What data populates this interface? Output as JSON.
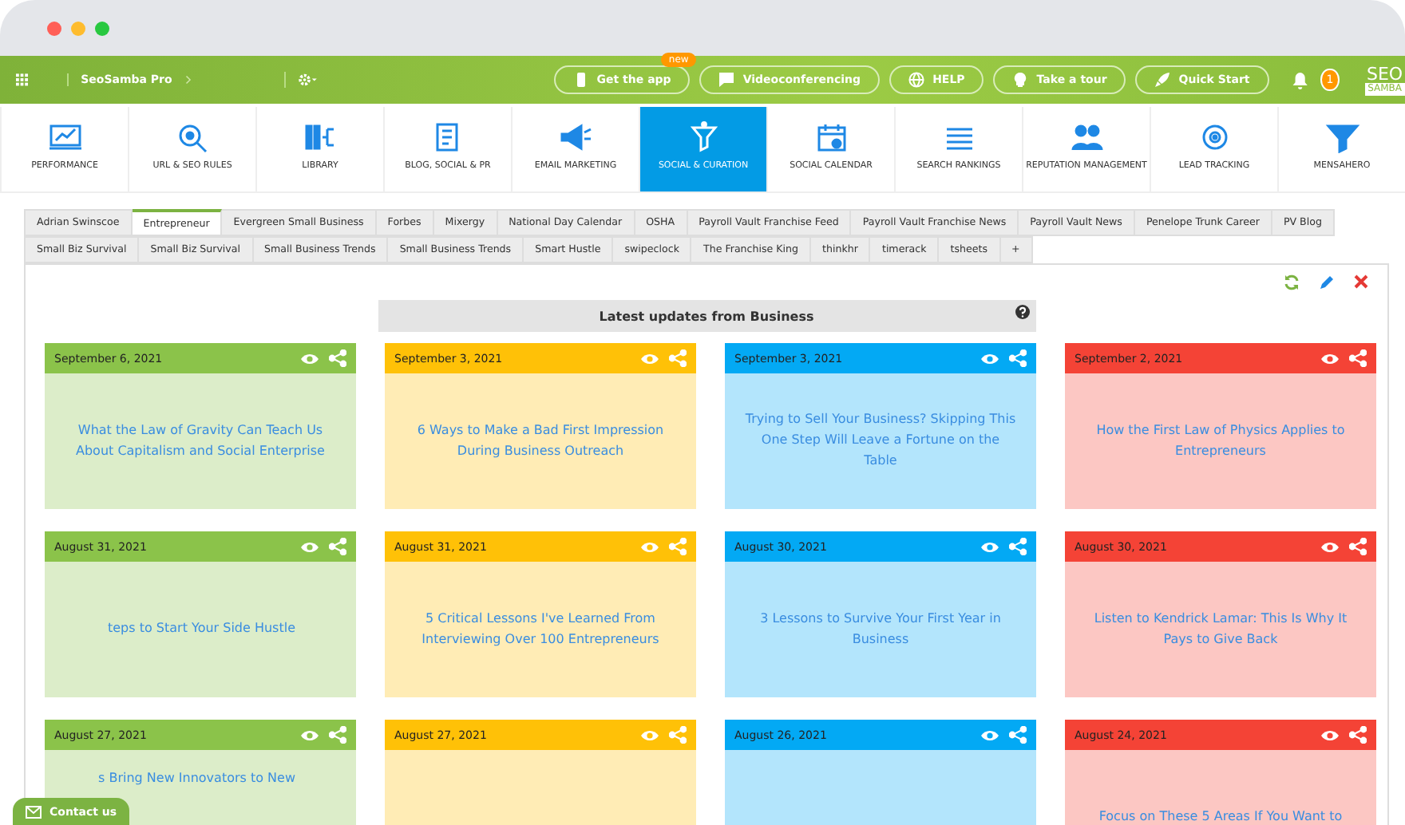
{
  "topbar": {
    "product": "SeoSamba Pro",
    "buttons": [
      {
        "kind": "app",
        "label": "Get the app",
        "badge": "new"
      },
      {
        "kind": "video",
        "label": "Videoconferencing"
      },
      {
        "kind": "help",
        "label": "HELP"
      },
      {
        "kind": "tour",
        "label": "Take a tour"
      },
      {
        "kind": "start",
        "label": "Quick Start"
      }
    ],
    "notifications": "1",
    "logo": {
      "top": "SEO",
      "bottom": "SAMBA"
    }
  },
  "nav": [
    {
      "kind": "performance",
      "label": "PERFORMANCE",
      "selected": false
    },
    {
      "kind": "url",
      "label": "URL & SEO RULES",
      "selected": false
    },
    {
      "kind": "library",
      "label": "LIBRARY",
      "selected": false
    },
    {
      "kind": "blog",
      "label": "BLOG, SOCIAL & PR",
      "selected": false
    },
    {
      "kind": "email",
      "label": "EMAIL MARKETING",
      "selected": false
    },
    {
      "kind": "social",
      "label": "SOCIAL & CURATION",
      "selected": true
    },
    {
      "kind": "calendar",
      "label": "SOCIAL CALENDAR",
      "selected": false
    },
    {
      "kind": "rankings",
      "label": "SEARCH RANKINGS",
      "selected": false
    },
    {
      "kind": "reputation",
      "label": "REPUTATION MANAGEMENT",
      "selected": false
    },
    {
      "kind": "lead",
      "label": "LEAD TRACKING",
      "selected": false
    },
    {
      "kind": "mensahero",
      "label": "MENSAHERO",
      "selected": false
    }
  ],
  "tab_rows": [
    [
      {
        "label": "Adrian Swinscoe",
        "selected": false
      },
      {
        "label": "Entrepreneur",
        "selected": true
      },
      {
        "label": "Evergreen Small Business",
        "selected": false
      },
      {
        "label": "Forbes",
        "selected": false
      },
      {
        "label": "Mixergy",
        "selected": false
      },
      {
        "label": "National Day Calendar",
        "selected": false
      },
      {
        "label": "OSHA",
        "selected": false
      },
      {
        "label": "Payroll Vault Franchise Feed",
        "selected": false
      },
      {
        "label": "Payroll Vault Franchise News",
        "selected": false
      },
      {
        "label": "Payroll Vault News",
        "selected": false
      },
      {
        "label": "Penelope Trunk Career",
        "selected": false
      },
      {
        "label": "PV Blog",
        "selected": false
      }
    ],
    [
      {
        "label": "Small Biz Survival",
        "selected": false
      },
      {
        "label": "Small Biz Survival",
        "selected": false
      },
      {
        "label": "Small Business Trends",
        "selected": false
      },
      {
        "label": "Small Business Trends",
        "selected": false
      },
      {
        "label": "Smart Hustle",
        "selected": false
      },
      {
        "label": "swipeclock",
        "selected": false
      },
      {
        "label": "The Franchise King",
        "selected": false
      },
      {
        "label": "thinkhr",
        "selected": false
      },
      {
        "label": "timerack",
        "selected": false
      },
      {
        "label": "tsheets",
        "selected": false
      },
      {
        "label": "+",
        "selected": false
      }
    ]
  ],
  "panel": {
    "title": "Latest updates from Business",
    "cards": [
      {
        "date": "September 6, 2021",
        "title": "What the Law of Gravity Can Teach Us About Capitalism and Social Enterprise",
        "color": "#8bc34a"
      },
      {
        "date": "September 3, 2021",
        "title": "6 Ways to Make a Bad First Impression During Business Outreach",
        "color": "#ffc107"
      },
      {
        "date": "September 3, 2021",
        "title": "Trying to Sell Your Business? Skipping This One Step Will Leave a Fortune on the Table",
        "color": "#03a9f4"
      },
      {
        "date": "September 2, 2021",
        "title": "How the First Law of Physics Applies to Entrepreneurs",
        "color": "#f44336"
      },
      {
        "date": "August 31, 2021",
        "title": "teps to Start Your Side Hustle",
        "color": "#8bc34a"
      },
      {
        "date": "August 31, 2021",
        "title": "5 Critical Lessons I've Learned From Interviewing Over 100 Entrepreneurs",
        "color": "#ffc107"
      },
      {
        "date": "August 30, 2021",
        "title": "3 Lessons to Survive Your First Year in Business",
        "color": "#03a9f4"
      },
      {
        "date": "August 30, 2021",
        "title": "Listen to Kendrick Lamar: This Is Why It Pays to Give Back",
        "color": "#f44336"
      },
      {
        "date": "August 27, 2021",
        "title": "s Bring New Innovators to New",
        "color": "#8bc34a"
      },
      {
        "date": "August 27, 2021",
        "color": "#ffc107"
      },
      {
        "date": "August 26, 2021",
        "color": "#03a9f4"
      },
      {
        "date": "August 24, 2021",
        "title": "Focus on These 5 Areas If You Want to",
        "color": "#f44336"
      }
    ]
  },
  "overlay": {
    "contact": "Contact us"
  }
}
